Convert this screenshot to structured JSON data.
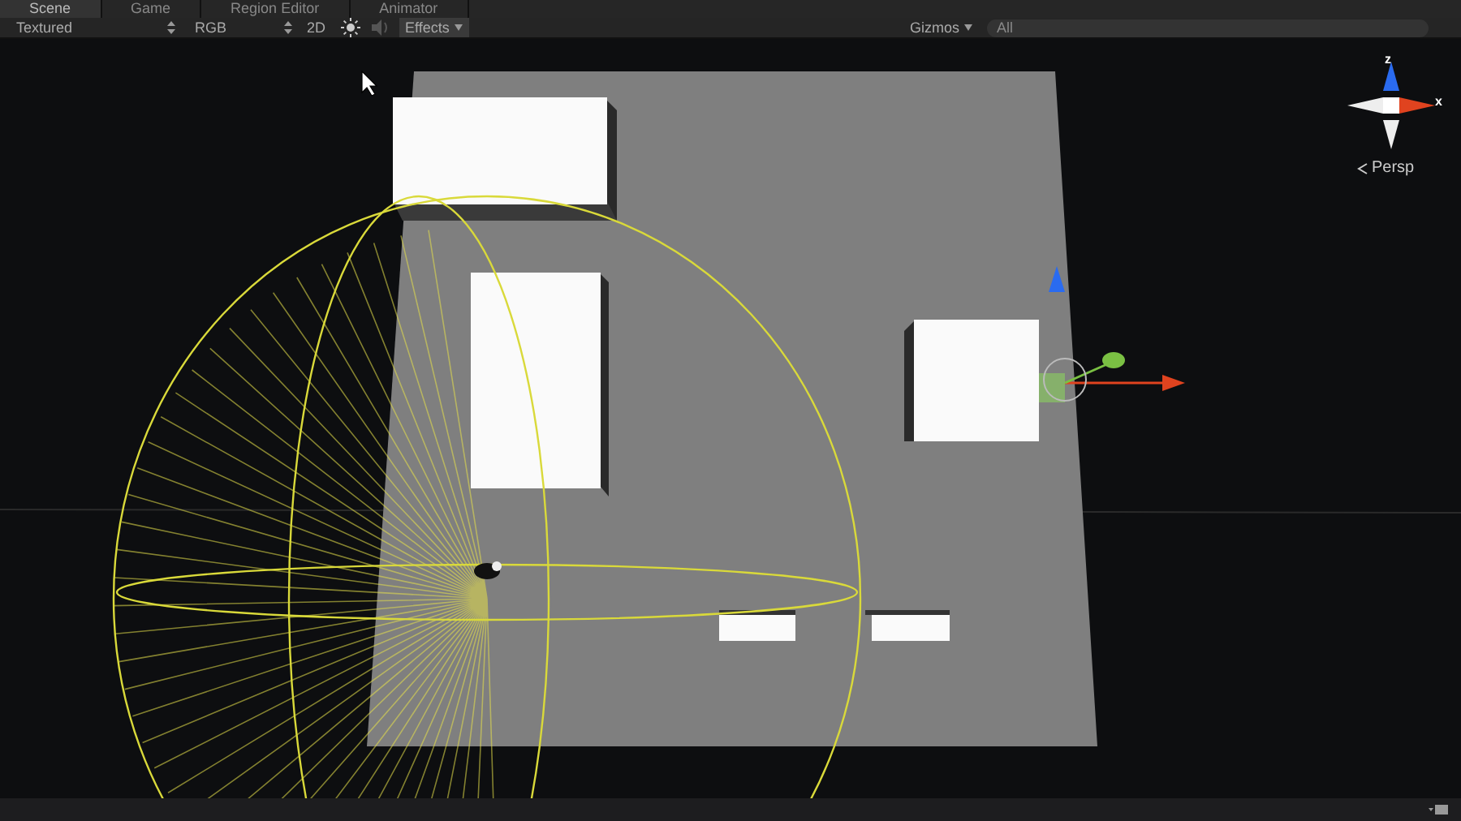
{
  "tabs": [
    {
      "label": "Scene",
      "selected": true
    },
    {
      "label": "Game",
      "selected": false
    },
    {
      "label": "Region Editor",
      "selected": false
    },
    {
      "label": "Animator",
      "selected": false
    }
  ],
  "toolbar": {
    "shading": "Textured",
    "render_mode": "RGB",
    "mode_2d": "2D",
    "effects": "Effects",
    "gizmos": "Gizmos",
    "search": {
      "placeholder": "All"
    }
  },
  "view_gizmo": {
    "axes": [
      "z",
      "x"
    ],
    "projection": "Persp"
  }
}
